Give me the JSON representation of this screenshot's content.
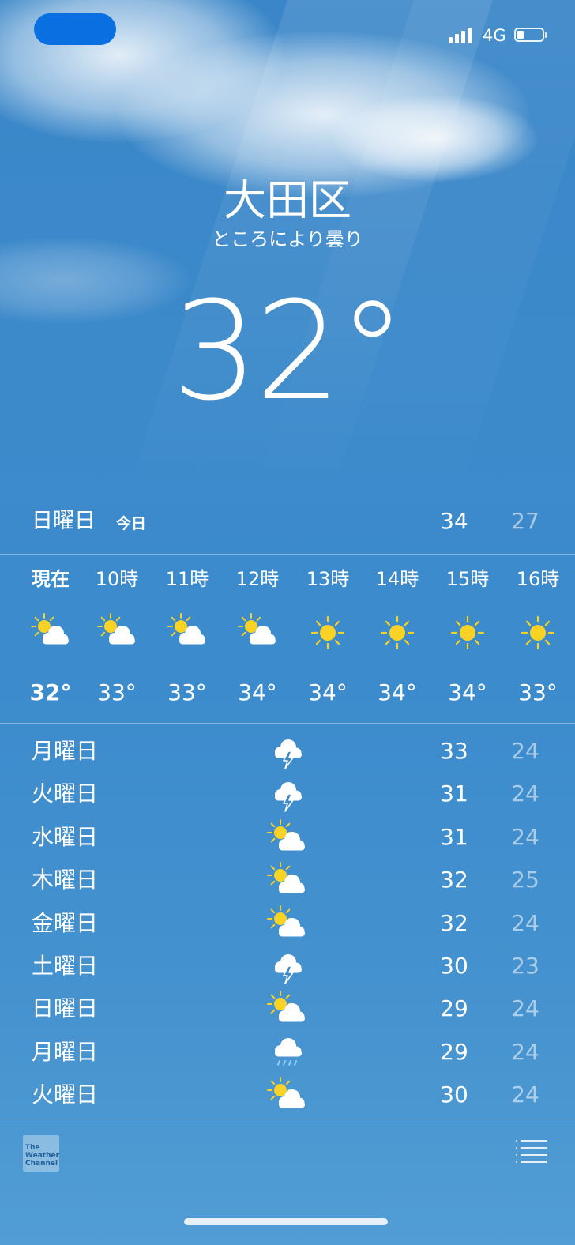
{
  "status_bar": {
    "network": "4G",
    "signal_bars": 4,
    "battery_level": 0.25
  },
  "header": {
    "city": "大田区",
    "condition": "ところにより曇り",
    "temperature": "32°"
  },
  "today": {
    "day": "日曜日",
    "tag": "今日",
    "high": "34",
    "low": "27"
  },
  "hourly": [
    {
      "time": "現在",
      "icon": "partly-sunny-icon",
      "temp": "32°",
      "current": true
    },
    {
      "time": "10時",
      "icon": "partly-sunny-icon",
      "temp": "33°"
    },
    {
      "time": "11時",
      "icon": "partly-sunny-icon",
      "temp": "33°"
    },
    {
      "time": "12時",
      "icon": "partly-sunny-icon",
      "temp": "34°"
    },
    {
      "time": "13時",
      "icon": "sun-icon",
      "temp": "34°"
    },
    {
      "time": "14時",
      "icon": "sun-icon",
      "temp": "34°"
    },
    {
      "time": "15時",
      "icon": "sun-icon",
      "temp": "34°"
    },
    {
      "time": "16時",
      "icon": "sun-icon",
      "temp": "33°"
    }
  ],
  "daily": [
    {
      "day": "月曜日",
      "icon": "thunderstorm-icon",
      "high": "33",
      "low": "24"
    },
    {
      "day": "火曜日",
      "icon": "thunderstorm-icon",
      "high": "31",
      "low": "24"
    },
    {
      "day": "水曜日",
      "icon": "partly-sunny-icon",
      "high": "31",
      "low": "24"
    },
    {
      "day": "木曜日",
      "icon": "partly-sunny-icon",
      "high": "32",
      "low": "25"
    },
    {
      "day": "金曜日",
      "icon": "partly-sunny-icon",
      "high": "32",
      "low": "24"
    },
    {
      "day": "土曜日",
      "icon": "thunderstorm-icon",
      "high": "30",
      "low": "23"
    },
    {
      "day": "日曜日",
      "icon": "partly-sunny-icon",
      "high": "29",
      "low": "24"
    },
    {
      "day": "月曜日",
      "icon": "rain-icon",
      "high": "29",
      "low": "24"
    },
    {
      "day": "火曜日",
      "icon": "partly-sunny-icon",
      "high": "30",
      "low": "24"
    }
  ],
  "footer": {
    "logo_lines": [
      "The",
      "Weather",
      "Channel"
    ],
    "list_icon": "list-icon"
  },
  "colors": {
    "sun": "#f8d225",
    "status_pill": "#0a6fe0"
  }
}
